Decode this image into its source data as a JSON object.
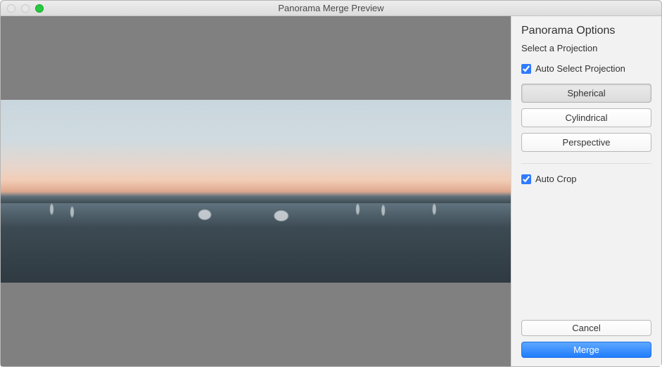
{
  "window": {
    "title": "Panorama Merge Preview"
  },
  "sidebar": {
    "heading": "Panorama Options",
    "sub": "Select a Projection",
    "auto_select_label": "Auto Select Projection",
    "auto_select_checked": true,
    "projections": {
      "spherical": {
        "label": "Spherical",
        "selected": true
      },
      "cylindrical": {
        "label": "Cylindrical",
        "selected": false
      },
      "perspective": {
        "label": "Perspective",
        "selected": false
      }
    },
    "auto_crop_label": "Auto Crop",
    "auto_crop_checked": true
  },
  "footer": {
    "cancel": "Cancel",
    "merge": "Merge"
  }
}
